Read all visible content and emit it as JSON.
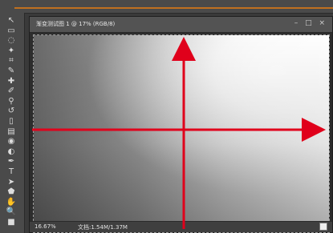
{
  "window": {
    "title": "渐变测试图 1 @ 17% (RGB/8)",
    "controls": "– □ ×"
  },
  "statusbar": {
    "zoom": "16.67%",
    "doc_size": "文档:1.54M/1.37M"
  },
  "tools": [
    {
      "icon": "move-icon",
      "glyph": "↖"
    },
    {
      "icon": "marquee-icon",
      "glyph": "▭"
    },
    {
      "icon": "lasso-icon",
      "glyph": "◌"
    },
    {
      "icon": "quick-select-icon",
      "glyph": "✦"
    },
    {
      "icon": "crop-icon",
      "glyph": "⌗"
    },
    {
      "icon": "eyedropper-icon",
      "glyph": "✎"
    },
    {
      "icon": "spot-heal-icon",
      "glyph": "✚"
    },
    {
      "icon": "brush-icon",
      "glyph": "✐"
    },
    {
      "icon": "clone-stamp-icon",
      "glyph": "⚲"
    },
    {
      "icon": "history-brush-icon",
      "glyph": "↺"
    },
    {
      "icon": "eraser-icon",
      "glyph": "▯"
    },
    {
      "icon": "gradient-icon",
      "glyph": "▤"
    },
    {
      "icon": "blur-icon",
      "glyph": "◉"
    },
    {
      "icon": "dodge-icon",
      "glyph": "◐"
    },
    {
      "icon": "pen-icon",
      "glyph": "✒"
    },
    {
      "icon": "type-icon",
      "glyph": "T"
    },
    {
      "icon": "path-select-icon",
      "glyph": "➤"
    },
    {
      "icon": "shape-icon",
      "glyph": "⬟"
    },
    {
      "icon": "hand-icon",
      "glyph": "✋"
    },
    {
      "icon": "zoom-icon",
      "glyph": "🔍"
    },
    {
      "icon": "color-swatches-icon",
      "glyph": "■"
    }
  ],
  "annotation": {
    "arrow_color": "#e0001b"
  }
}
